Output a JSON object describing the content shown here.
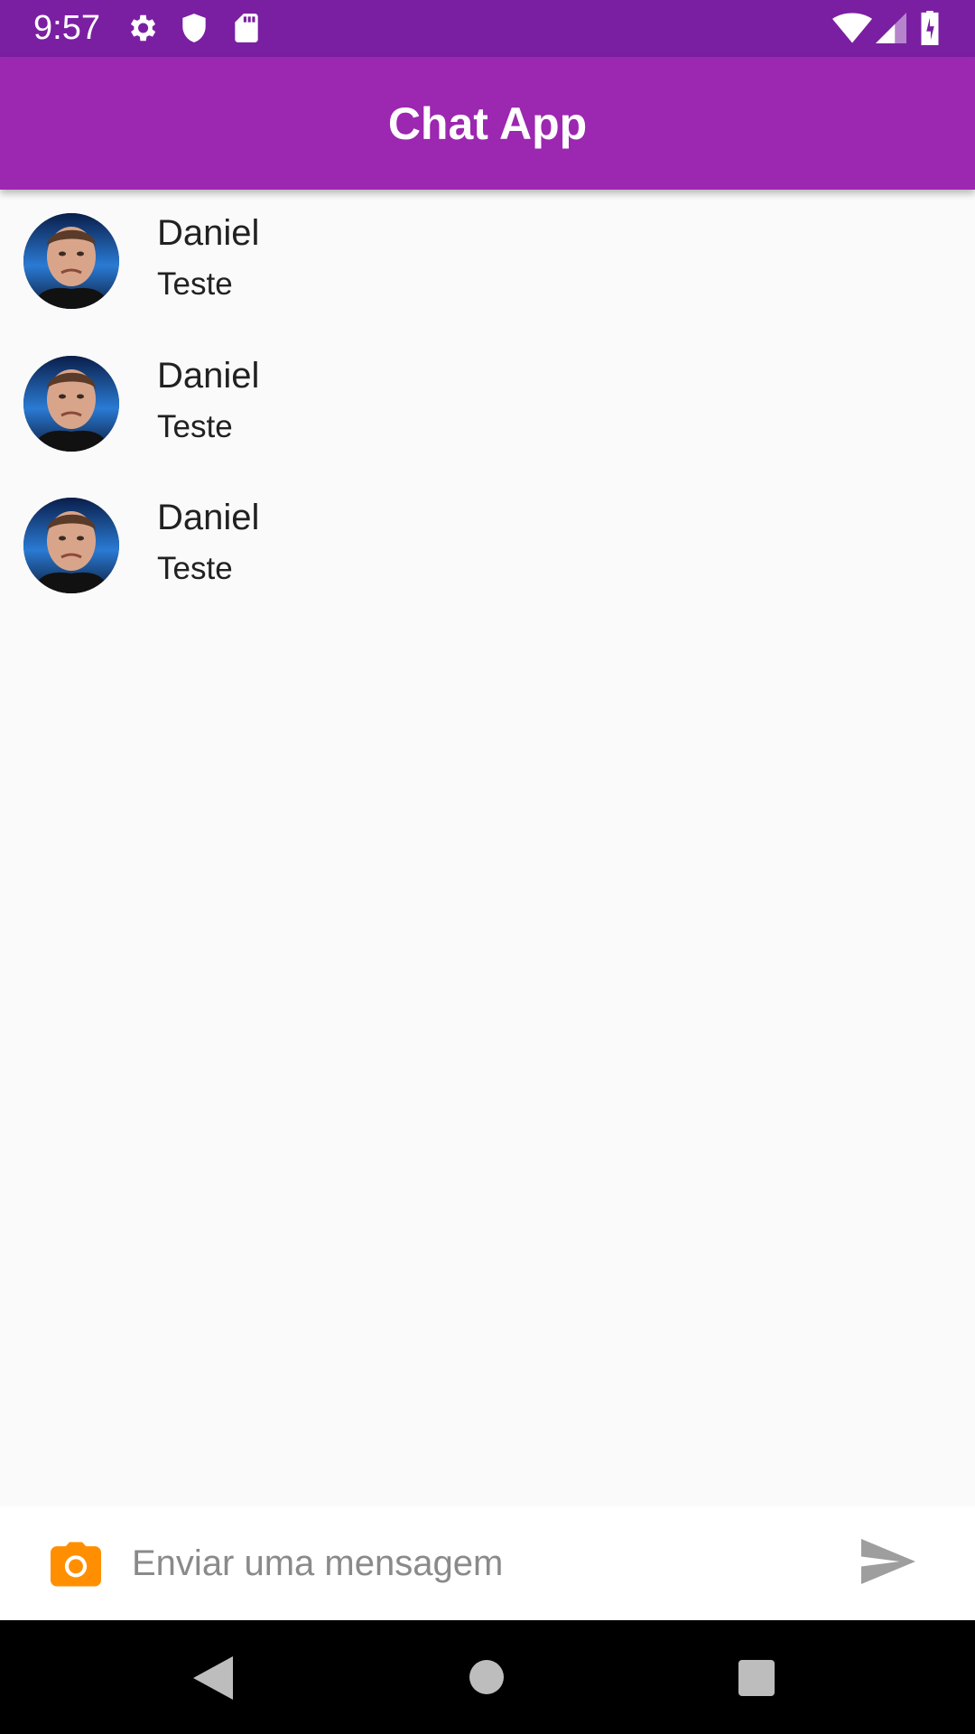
{
  "status_bar": {
    "time": "9:57",
    "left_icons": [
      "gear-icon",
      "shield-icon",
      "sd-card-icon"
    ],
    "right_icons": [
      "wifi-icon",
      "cellular-signal-icon",
      "battery-charging-icon"
    ]
  },
  "app_bar": {
    "title": "Chat App",
    "color": "#9c27b0"
  },
  "messages": [
    {
      "sender": "Daniel",
      "text": "Teste",
      "avatar": "user-avatar-photo"
    },
    {
      "sender": "Daniel",
      "text": "Teste",
      "avatar": "user-avatar-photo"
    },
    {
      "sender": "Daniel",
      "text": "Teste",
      "avatar": "user-avatar-photo"
    }
  ],
  "composer": {
    "placeholder": "Enviar uma mensagem",
    "value": "",
    "camera_icon": "camera-icon",
    "camera_color": "#ff8f00",
    "send_icon": "send-icon"
  },
  "nav_bar": {
    "buttons": [
      "back-icon",
      "home-icon",
      "recents-icon"
    ]
  }
}
